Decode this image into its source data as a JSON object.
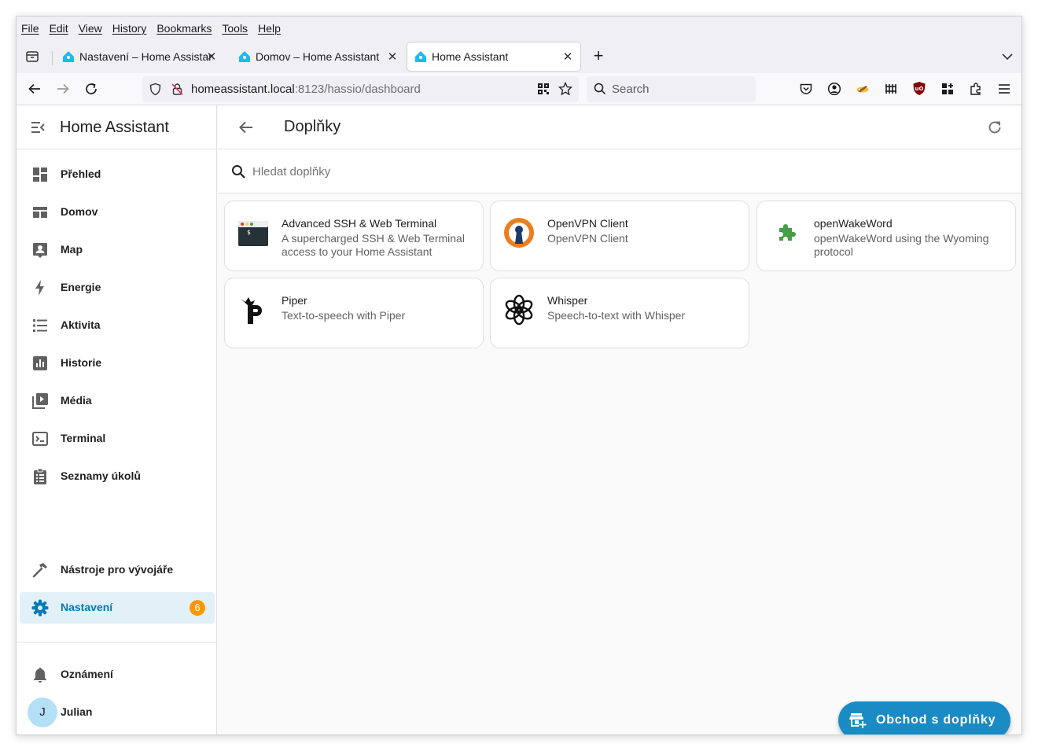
{
  "browser": {
    "menu": [
      "File",
      "Edit",
      "View",
      "History",
      "Bookmarks",
      "Tools",
      "Help"
    ],
    "tabs": [
      {
        "title": "Nastavení – Home Assistan",
        "active": false
      },
      {
        "title": "Domov – Home Assistant",
        "active": false
      },
      {
        "title": "Home Assistant",
        "active": true
      }
    ],
    "url_host": "homeassistant.local",
    "url_path": ":8123/hassio/dashboard",
    "search_placeholder": "Search"
  },
  "sidebar": {
    "title": "Home Assistant",
    "items": [
      {
        "label": "Přehled",
        "icon": "dashboard-icon"
      },
      {
        "label": "Domov",
        "icon": "view-dashboard-icon"
      },
      {
        "label": "Map",
        "icon": "map-account-icon"
      },
      {
        "label": "Energie",
        "icon": "lightning-bolt-icon"
      },
      {
        "label": "Aktivita",
        "icon": "format-list-icon"
      },
      {
        "label": "Historie",
        "icon": "chart-box-icon"
      },
      {
        "label": "Média",
        "icon": "play-box-multiple-icon"
      },
      {
        "label": "Terminal",
        "icon": "console-icon"
      },
      {
        "label": "Seznamy úkolů",
        "icon": "clipboard-list-icon"
      }
    ],
    "dev_tools": "Nástroje pro vývojáře",
    "settings": "Nastavení",
    "settings_badge": "6",
    "notifications": "Oznámení",
    "user_initial": "J",
    "user_name": "Julian"
  },
  "main": {
    "title": "Doplňky",
    "search_placeholder": "Hledat doplňky",
    "addons": [
      {
        "name": "Advanced SSH & Web Terminal",
        "desc": "A supercharged SSH & Web Terminal access to your Home Assistant",
        "icon": "terminal-app-icon"
      },
      {
        "name": "OpenVPN Client",
        "desc": "OpenVPN Client",
        "icon": "openvpn-icon"
      },
      {
        "name": "openWakeWord",
        "desc": "openWakeWord using the Wyoming protocol",
        "icon": "puzzle-icon"
      },
      {
        "name": "Piper",
        "desc": "Text-to-speech with Piper",
        "icon": "piper-icon"
      },
      {
        "name": "Whisper",
        "desc": "Speech-to-text with Whisper",
        "icon": "openai-icon"
      }
    ],
    "store_button": "Obchod s doplňky"
  },
  "colors": {
    "accent": "#03a9f4",
    "fab": "#1a8bc5",
    "selected_bg": "#e2f1f8",
    "badge": "#ff9800",
    "puzzle": "#43a047",
    "openvpn_orange": "#ea7e20"
  }
}
